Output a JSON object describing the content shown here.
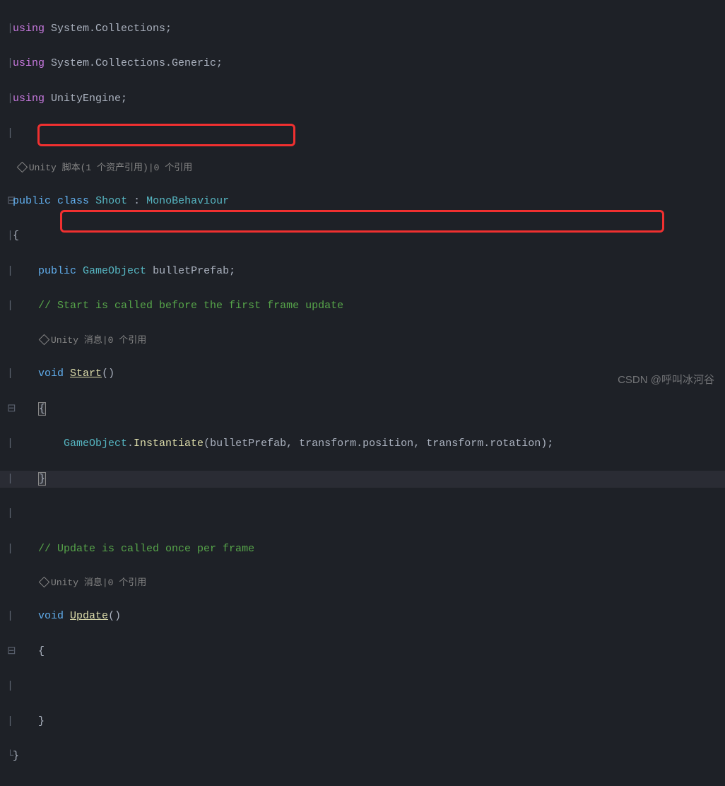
{
  "code": {
    "using1_kw": "using",
    "using1_ns": " System.Collections;",
    "using2_kw": "using",
    "using2_ns": " System.Collections.Generic;",
    "using3_kw": "using",
    "using3_ns": " UnityEngine;",
    "codelens1": "Unity 脚本(1 个资产引用)|0 个引用",
    "public_kw": "public",
    "class_kw": "class",
    "class_name": "Shoot",
    "colon": " : ",
    "base_class": "MonoBehaviour",
    "brace_open": "{",
    "field_public": "public",
    "field_type": "GameObject",
    "field_name": " bulletPrefab;",
    "comment1": "// Start is called before the first frame update",
    "codelens2": "Unity 消息|0 个引用",
    "void_kw": "void",
    "start_name": "Start",
    "parens": "()",
    "start_brace_open": "{",
    "inst_type": "GameObject",
    "inst_dot": ".",
    "inst_method": "Instantiate",
    "inst_open": "(",
    "inst_arg1": "bulletPrefab",
    "inst_comma1": ", ",
    "inst_arg2a": "transform",
    "inst_dot2": ".",
    "inst_arg2b": "position",
    "inst_comma2": ", ",
    "inst_arg3a": "transform",
    "inst_dot3": ".",
    "inst_arg3b": "rotation",
    "inst_close": ");",
    "start_brace_close": "}",
    "comment2": "// Update is called once per frame",
    "codelens3": "Unity 消息|0 个引用",
    "update_name": "Update",
    "update_brace_open": "{",
    "update_brace_close": "}",
    "class_brace_close": "}"
  },
  "watermark": "CSDN @呼叫冰河谷"
}
